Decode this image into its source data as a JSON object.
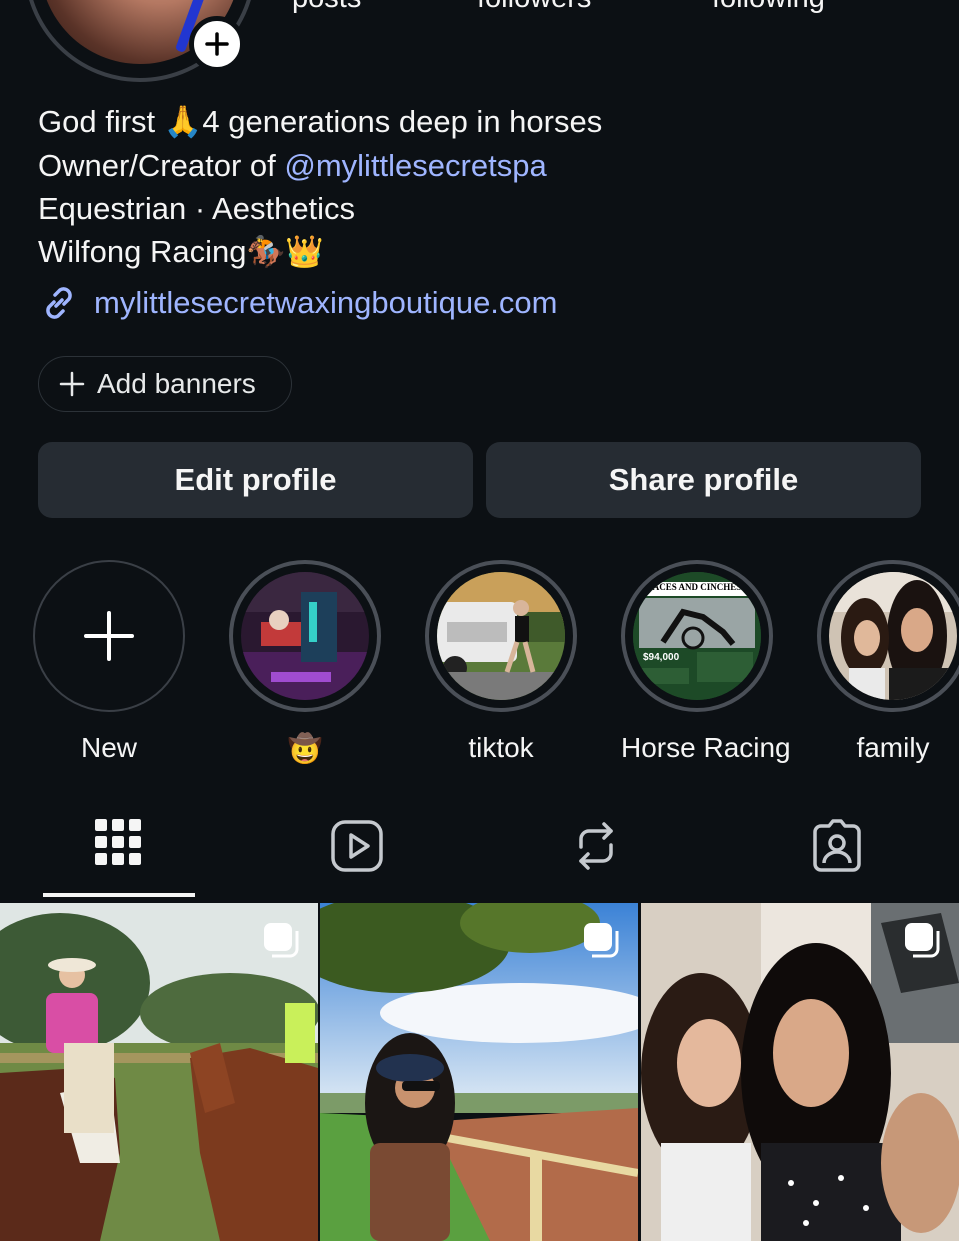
{
  "profile": {
    "stats": {
      "posts_label": "posts",
      "followers_label": "followers",
      "following_label": "following"
    },
    "bio": {
      "line1_a": "God first ",
      "line1_emoji": "🙏",
      "line1_b": "4 generations deep in horses",
      "line2_a": "Owner/Creator of ",
      "line2_mention": "@mylittlesecretspa",
      "line3": "Equestrian · Aesthetics",
      "line4_a": "Wilfong Racing",
      "line4_emoji": "🏇👑"
    },
    "link": "mylittlesecretwaxingboutique.com",
    "add_banners_label": "Add banners",
    "edit_profile_label": "Edit profile",
    "share_profile_label": "Share profile"
  },
  "highlights": [
    {
      "label": "New"
    },
    {
      "label": "🤠"
    },
    {
      "label": "tiktok"
    },
    {
      "label": "Horse Racing"
    },
    {
      "label": "family"
    }
  ],
  "horse_racing_thumb": {
    "headline": "ACES AND CINCHES",
    "amount": "$94,000"
  },
  "tabs": [
    {
      "name": "posts",
      "icon": "grid-icon"
    },
    {
      "name": "reels",
      "icon": "reels-icon"
    },
    {
      "name": "reposts",
      "icon": "repost-icon"
    },
    {
      "name": "tagged",
      "icon": "tagged-icon"
    }
  ],
  "colors": {
    "background": "#0c1014",
    "button": "#262c33",
    "link": "#9fb5ff",
    "text": "#f5f5f5"
  }
}
